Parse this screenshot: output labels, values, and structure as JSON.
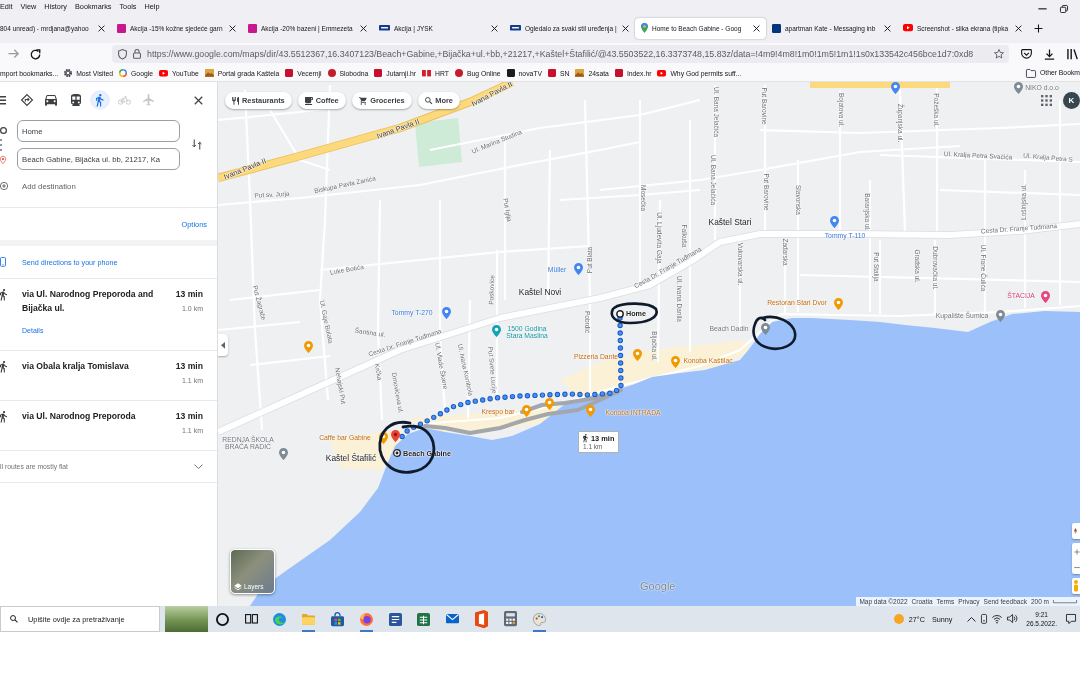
{
  "browser": {
    "menu": [
      "Edit",
      "View",
      "History",
      "Bookmarks",
      "Tools",
      "Help"
    ],
    "tabs": [
      {
        "title": "804 unread) - mrdjana@yahoo",
        "kind": "plain",
        "selected": false
      },
      {
        "title": "Akcija -15% kožne sjedeće garn",
        "kind": "tile",
        "selected": false
      },
      {
        "title": "Akcija -20% bazeni | Emmezeta",
        "kind": "tile",
        "selected": false
      },
      {
        "title": "Akcija | JYSK",
        "kind": "bar",
        "selected": false
      },
      {
        "title": "Ogledalo za svaki stil uređenja |",
        "kind": "bar",
        "selected": false
      },
      {
        "title": "Home to Beach Gabine - Goog",
        "kind": "pin",
        "selected": true
      },
      {
        "title": "apartman Kate - Messaging inb",
        "kind": "square",
        "selected": false
      },
      {
        "title": "Screenshot - slika ekrana (tipka",
        "kind": "video",
        "selected": false
      }
    ],
    "url": "https://www.google.com/maps/dir/43.5512367,16.3407123/Beach+Gabine,+Bijačka+ul.+bb,+21217,+Kaštel+Štafilić/@43.5503522,16.3373748,15.83z/data=!4m9!4m8!1m0!1m5!1m1!1s0x133542c456bce1d7:0xd8",
    "bookmarks": [
      {
        "label": "mport bookmarks...",
        "kind": "plain"
      },
      {
        "label": "Most Visited",
        "kind": "gear"
      },
      {
        "label": "Google",
        "kind": "ring"
      },
      {
        "label": "YouTube",
        "kind": "video"
      },
      {
        "label": "Portal grada Kaštela",
        "kind": "image"
      },
      {
        "label": "Vecernji",
        "kind": "tile"
      },
      {
        "label": "Slobodna",
        "kind": "dot"
      },
      {
        "label": "Jutarnji.hr",
        "kind": "tile"
      },
      {
        "label": "HRT",
        "kind": "squares"
      },
      {
        "label": "Bug Online",
        "kind": "dot"
      },
      {
        "label": "novaTV",
        "kind": "dark"
      },
      {
        "label": "SN",
        "kind": "tile"
      },
      {
        "label": "24sata",
        "kind": "image"
      },
      {
        "label": "Index.hr",
        "kind": "tile"
      },
      {
        "label": "Why God permits suff...",
        "kind": "video"
      }
    ],
    "other_bookmarks": "Other Bookm"
  },
  "directions": {
    "modes": [
      {
        "kind": "best",
        "selected": false,
        "disabled": false
      },
      {
        "kind": "car",
        "selected": false,
        "disabled": false
      },
      {
        "kind": "transit",
        "selected": false,
        "disabled": false
      },
      {
        "kind": "walk",
        "selected": true,
        "disabled": false
      },
      {
        "kind": "bike",
        "selected": false,
        "disabled": true
      },
      {
        "kind": "plane",
        "selected": false,
        "disabled": true
      }
    ],
    "origin": "Home",
    "destination": "Beach Gabine, Bijačka ul. bb, 21217, Ka",
    "add_destination": "Add destination",
    "options": "Options",
    "send_to_phone": "Send directions to your phone",
    "routes": [
      {
        "name": "via Ul. Narodnog Preporoda and Bijačka ul.",
        "duration": "13 min",
        "distance": "1.0 km",
        "details": "Details"
      },
      {
        "name": "via Obala kralja Tomislava",
        "duration": "13 min",
        "distance": "1.1 km"
      },
      {
        "name": "via Ul. Narodnog Preporoda",
        "duration": "13 min",
        "distance": "1.1 km"
      }
    ],
    "note": "ll routes are mostly flat"
  },
  "map": {
    "chips": [
      {
        "label": "Restaurants",
        "kind": "food"
      },
      {
        "label": "Coffee",
        "kind": "coffee"
      },
      {
        "label": "Groceries",
        "kind": "cart"
      },
      {
        "label": "More",
        "kind": "search"
      }
    ],
    "account": "K",
    "highways": [
      "Ivana Pavla II",
      "Ivana Pavla II",
      "Ivana Pavla II"
    ],
    "streets": [
      "Ul. Marina Studina",
      "Biskupa Pavla Zanića",
      "Put sv. Jurja",
      "Luke Botića",
      "Put Žagrače",
      "Ul. Gaje Bulata",
      "Šantina ul.",
      "Cesta Dr. Franje Tuđmana",
      "Krčka",
      "Nehajski Put",
      "Ul. Vlade Škarre",
      "Ul. Ivana Kombola",
      "Put Svete Lucije",
      "Drnovićeva ul.",
      "Poskovice",
      "Put Igija",
      "Put Blata",
      "Pobrdić",
      "Mosečka",
      "Ul. Bana Jelačića",
      "Ul. Bana Jelačića",
      "Put Barovine",
      "Put Barovine",
      "Slavonska",
      "Bojatova ul.",
      "Županjska ul.",
      "Požeška ul.",
      "Ul. Kralja Petra Svačića",
      "Ul. Kralja Petra S",
      "Lošinjska ul.",
      "Baranjska ul.",
      "Ul. Ljudevita Gaja",
      "Falkuša",
      "Cesta Dr. Franje Tuđmana",
      "Cesta Dr. Franje Tuđmana",
      "Vukovarska ul.",
      "Zadarska",
      "Put Stalija",
      "Gradska ul.",
      "Dubrovačka ul.",
      "Ul. Frane Čulića",
      "Ul. Ivana Danila",
      "Bijačka ul."
    ],
    "towns": [
      "Kaštel Novi",
      "Kaštel Stari",
      "Kaštel Štafilić"
    ],
    "places": [
      {
        "name": "Müller",
        "kind": "shop"
      },
      {
        "name": "Tommy T-270",
        "kind": "shop"
      },
      {
        "name": "1500 Godina Stara Maslina",
        "kind": "sight"
      },
      {
        "name": "Pizzeria Dante",
        "kind": "food"
      },
      {
        "name": "Krespo bar",
        "kind": "food"
      },
      {
        "name": "Konoba INTRADA",
        "kind": "food"
      },
      {
        "name": "Konoba Kaštilac",
        "kind": "food"
      },
      {
        "name": "Caffe bar Gabine",
        "kind": "food"
      },
      {
        "name": "Restoran Stari Dvor",
        "kind": "food"
      },
      {
        "name": "Beach Dadin",
        "kind": "beach"
      },
      {
        "name": "Kupalište Šumica",
        "kind": "beach"
      },
      {
        "name": "ŠTACIJA",
        "kind": "hotel"
      },
      {
        "name": "Tommy T-110",
        "kind": "shop"
      },
      {
        "name": "REDNJA ŠKOLA BRAĆA RADIĆ",
        "kind": "school"
      },
      {
        "name": "NIKO d.o.o",
        "kind": "business"
      }
    ],
    "origin": "Home",
    "destination": "Beach Gabine",
    "callout": {
      "duration": "13 min",
      "distance": "1.1 km"
    },
    "layers": "Layers",
    "logo": "Google",
    "footer": {
      "attribution": "Map data ©2022",
      "links": [
        "Croatia",
        "Terms",
        "Privacy",
        "Send feedback"
      ],
      "scale": "200 m"
    }
  },
  "taskbar": {
    "search_placeholder": "Upišite ovdje za pretraživanje",
    "apps": [
      {
        "kind": "ring",
        "running": false
      },
      {
        "kind": "panes",
        "running": false
      },
      {
        "kind": "wave",
        "running": false
      },
      {
        "kind": "folder",
        "running": true
      },
      {
        "kind": "bag",
        "running": false
      },
      {
        "kind": "fox",
        "running": true
      },
      {
        "kind": "doc",
        "running": false
      },
      {
        "kind": "sheet",
        "running": false
      },
      {
        "kind": "mail",
        "running": false
      },
      {
        "kind": "office",
        "running": false
      },
      {
        "kind": "calc",
        "running": false
      },
      {
        "kind": "palette",
        "running": true
      }
    ],
    "temperature": "27°C",
    "weather": "Sunny",
    "time": "9:21",
    "date": "26.5.2022."
  }
}
